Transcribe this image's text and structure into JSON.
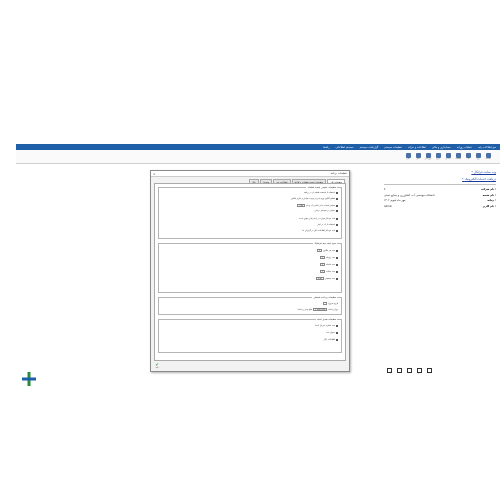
{
  "menubar": {
    "items": [
      "منو اطلاعات پایه",
      "عملیات روزانه",
      "حسابداری و مالی",
      "اطلاعات و خزانه",
      "تنظیمات سیستم",
      "گزارشات سیستم",
      "سیستم اطلاعاتی",
      "راهنما"
    ]
  },
  "toolbar": {
    "buttons": [
      "تنظیمات",
      "ورود",
      "چاپ",
      "اطلاعات",
      "پشتیبان",
      "خروج",
      "بروزرسانی",
      "اعلان",
      "تقویم"
    ]
  },
  "sidebar": {
    "link1": "* وب سایت فرانگار",
    "link2": "* دریافت خدمات الکترونیک",
    "rows": [
      {
        "k": "نام شرکت :",
        "v": "1"
      },
      {
        "k": "نام شعبه :",
        "v": "دانشکده مهندسی آب، کشاورزی و صنایع دستی"
      },
      {
        "k": "رمانه :",
        "v": "۱۴۰۲ مهر ماه تقویم"
      },
      {
        "k": "نام کاربر :",
        "v": "admin"
      }
    ]
  },
  "dialog": {
    "title": "تنظیمات برنامه",
    "close": "×",
    "tabs": [
      "تنظیمات کلی",
      "تنظیمات لیست قطعات و کالاها",
      "اطلاعات پایه",
      "صندوق",
      "بانک"
    ],
    "sec1_title": "تنظیمات عمومی لیست قطعات",
    "sec1_lines": [
      "استفاده از قسمت نقطه دار در برنامه",
      "تنظیم الگوی ورود فرم و ترتیب نمایش و تکرار فاکتور",
      "نمایش لیست ها بر اساس کد و نام",
      "نمایش در منوهای درختی",
      "ثبت خودکار موارد در بازه زمانی تعیین شده",
      "استفاده از کد در انبار",
      "ثبت خودکار اطلاعات انبار در گزارش ها"
    ],
    "sec2_title": "نحوه ایجاد سند اتوماتیک",
    "sec2_lines": [
      "سند هر فاکتور",
      "سند روزانه",
      "سند ماهانه",
      "سند سالانه",
      "سند تجمیعی"
    ],
    "sec3_title": "تنظیمات پرداخت قسطی",
    "sec3_lines": [
      "تاریخ شروع",
      "نوع پرداخت",
      "مبلغ پیش پرداخت"
    ],
    "sec4_title": "تنظیمات صدور اسناد",
    "sec4_lines": [
      "ثبت شماره سریال اسناد",
      "عنوان سند",
      "اطلاعات دیگر"
    ],
    "amount": "1,000,000",
    "select1": "مازاد",
    "select2": "تعداد",
    "ok": "تأیید"
  },
  "bottom_icons": [
    "بازگشت",
    "چاپ",
    "لیست",
    "پیام",
    "ذخیره"
  ]
}
